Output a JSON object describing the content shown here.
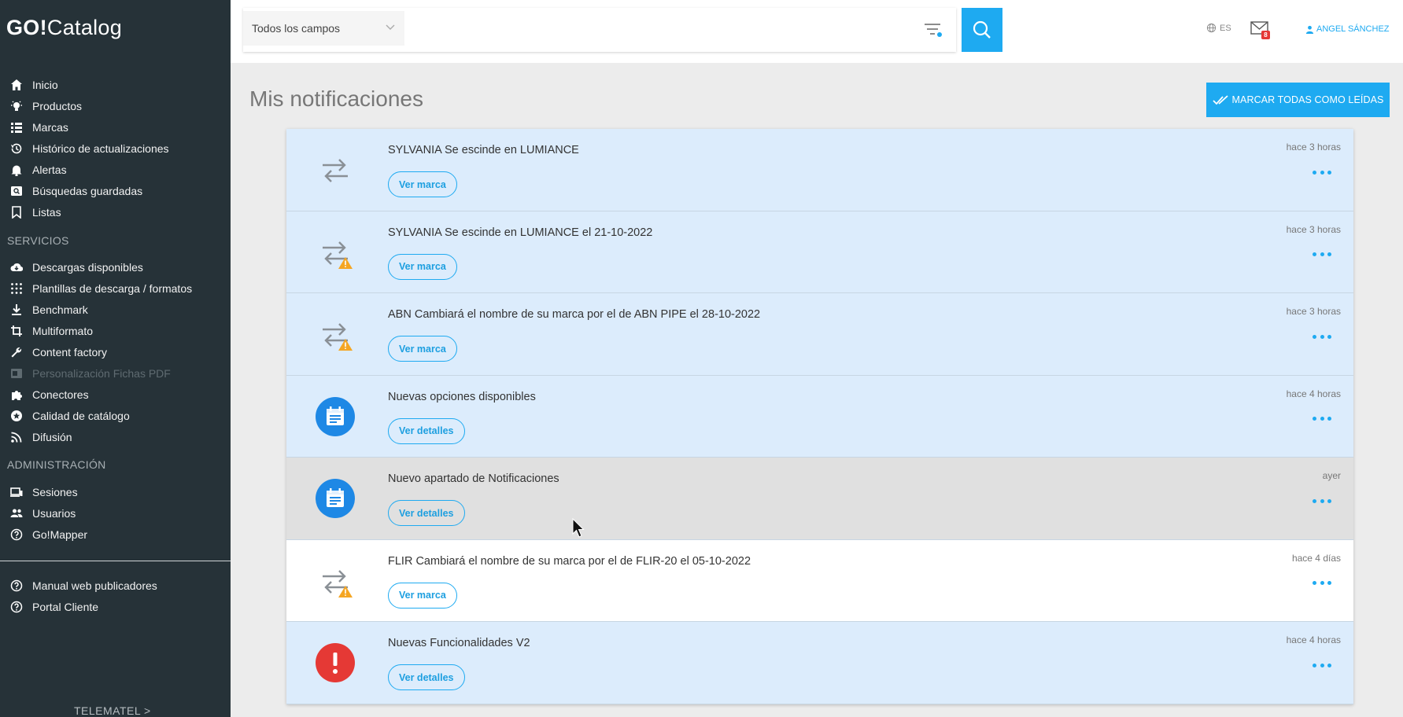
{
  "app": {
    "logo_bold": "GO!",
    "logo_rest": "Catalog"
  },
  "sidebar": {
    "main_items": [
      {
        "label": "Inicio",
        "icon": "home-icon"
      },
      {
        "label": "Productos",
        "icon": "bulb-icon"
      },
      {
        "label": "Marcas",
        "icon": "grid-icon"
      },
      {
        "label": "Histórico de actualizaciones",
        "icon": "history-icon"
      },
      {
        "label": "Alertas",
        "icon": "bell-icon"
      },
      {
        "label": "Búsquedas guardadas",
        "icon": "saved-search-icon"
      },
      {
        "label": "Listas",
        "icon": "bookmark-icon"
      }
    ],
    "services_title": "SERVICIOS",
    "services_items": [
      {
        "label": "Descargas disponibles",
        "icon": "cloud-download-icon"
      },
      {
        "label": "Plantillas de descarga / formatos",
        "icon": "dots-grid-icon"
      },
      {
        "label": "Benchmark",
        "icon": "download-icon"
      },
      {
        "label": "Multiformato",
        "icon": "crop-icon"
      },
      {
        "label": "Content factory",
        "icon": "wrench-icon"
      },
      {
        "label": "Personalización Fichas PDF",
        "icon": "pdf-icon",
        "disabled": true
      },
      {
        "label": "Conectores",
        "icon": "puzzle-icon"
      },
      {
        "label": "Calidad de catálogo",
        "icon": "star-circle-icon"
      },
      {
        "label": "Difusión",
        "icon": "rss-icon"
      }
    ],
    "admin_title": "ADMINISTRACIÓN",
    "admin_items": [
      {
        "label": "Sesiones",
        "icon": "devices-icon"
      },
      {
        "label": "Usuarios",
        "icon": "users-icon"
      },
      {
        "label": "Go!Mapper",
        "icon": "help-circle-icon"
      }
    ],
    "help_items": [
      {
        "label": "Manual web publicadores",
        "icon": "help-circle-icon"
      },
      {
        "label": "Portal Cliente",
        "icon": "help-circle-icon"
      }
    ],
    "brand_link": "TELEMATEL >"
  },
  "topbar": {
    "field_select": "Todos los campos",
    "search_placeholder": "",
    "language": "ES",
    "mail_badge": "8",
    "user_name": "ANGEL SÁNCHEZ"
  },
  "main": {
    "title": "Mis notificaciones",
    "mark_all_label": "MARCAR TODAS COMO LEÍDAS"
  },
  "notifications": [
    {
      "message": "SYLVANIA Se escinde en LUMIANCE",
      "button": "Ver marca",
      "time": "hace 3 horas",
      "icon": "swap-icon",
      "state": "unread"
    },
    {
      "message": "SYLVANIA Se escinde en LUMIANCE el 21-10-2022",
      "button": "Ver marca",
      "time": "hace 3 horas",
      "icon": "swap-warning-icon",
      "state": "unread"
    },
    {
      "message": "ABN Cambiará el nombre de su marca por el de ABN PIPE el 28-10-2022",
      "button": "Ver marca",
      "time": "hace 3 horas",
      "icon": "swap-warning-icon",
      "state": "unread"
    },
    {
      "message": "Nuevas opciones disponibles",
      "button": "Ver detalles",
      "time": "hace 4 horas",
      "icon": "calendar-note-icon",
      "state": "unread"
    },
    {
      "message": "Nuevo apartado de Notificaciones",
      "button": "Ver detalles",
      "time": "ayer",
      "icon": "calendar-note-icon",
      "state": "hover"
    },
    {
      "message": "FLIR Cambiará el nombre de su marca por el de FLIR-20 el 05-10-2022",
      "button": "Ver marca",
      "time": "hace 4 días",
      "icon": "swap-warning-icon",
      "state": "read"
    },
    {
      "message": "Nuevas Funcionalidades V2",
      "button": "Ver detalles",
      "time": "hace 4 horas",
      "icon": "alert-circle-icon",
      "state": "unread"
    }
  ],
  "colors": {
    "sidebar_bg": "#263238",
    "accent": "#1eaaf1",
    "unread_bg": "#dcecfc",
    "warning": "#f5a623",
    "error": "#e53935",
    "info": "#1e88e5"
  }
}
